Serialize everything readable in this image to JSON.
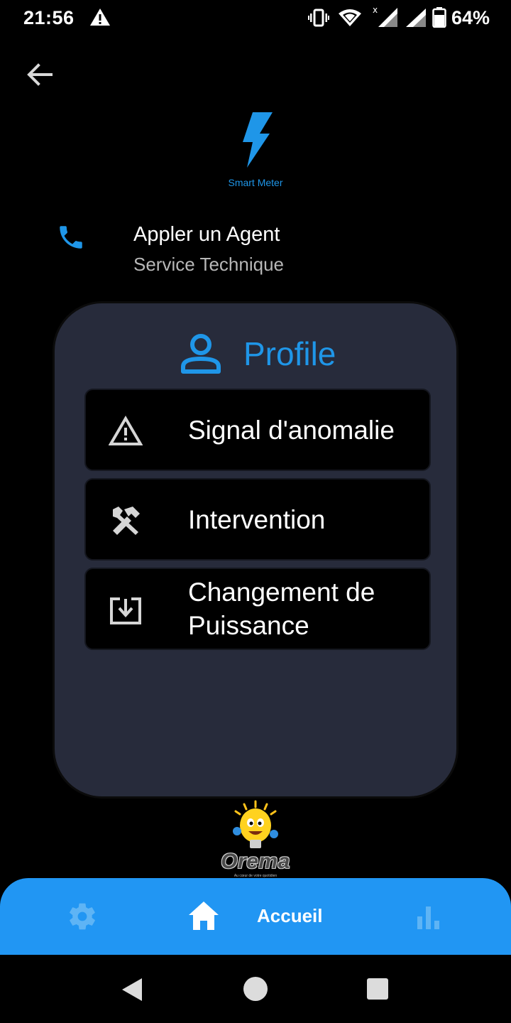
{
  "status_bar": {
    "time": "21:56",
    "battery_percent": "64%",
    "icons": [
      "alert-icon",
      "vibrate-icon",
      "wifi-icon",
      "signal-icon",
      "signal-icon",
      "battery-icon"
    ]
  },
  "header": {
    "back_icon": "arrow-left-icon",
    "logo_icon": "lightning-bolt-icon",
    "logo_text": "Smart Meter"
  },
  "call_agent": {
    "icon": "phone-icon",
    "title": "Appler un Agent",
    "subtitle": "Service Technique"
  },
  "profile": {
    "icon": "person-icon",
    "title": "Profile",
    "items": [
      {
        "icon": "warning-triangle-icon",
        "label": "Signal d'anomalie"
      },
      {
        "icon": "tools-icon",
        "label": "Intervention"
      },
      {
        "icon": "download-box-icon",
        "label": "Changement de Puissance"
      }
    ]
  },
  "brand": {
    "name": "Orema",
    "tagline": "Au cœur de votre quotidien"
  },
  "bottom_nav": {
    "items": [
      {
        "icon": "gear-icon",
        "label": ""
      },
      {
        "icon": "home-icon",
        "label": "Accueil",
        "active": true
      },
      {
        "icon": "bar-chart-icon",
        "label": ""
      }
    ]
  },
  "colors": {
    "accent": "#1f96e8",
    "nav_background": "#2196f3",
    "card_background": "#272b3b",
    "background": "#000000"
  }
}
